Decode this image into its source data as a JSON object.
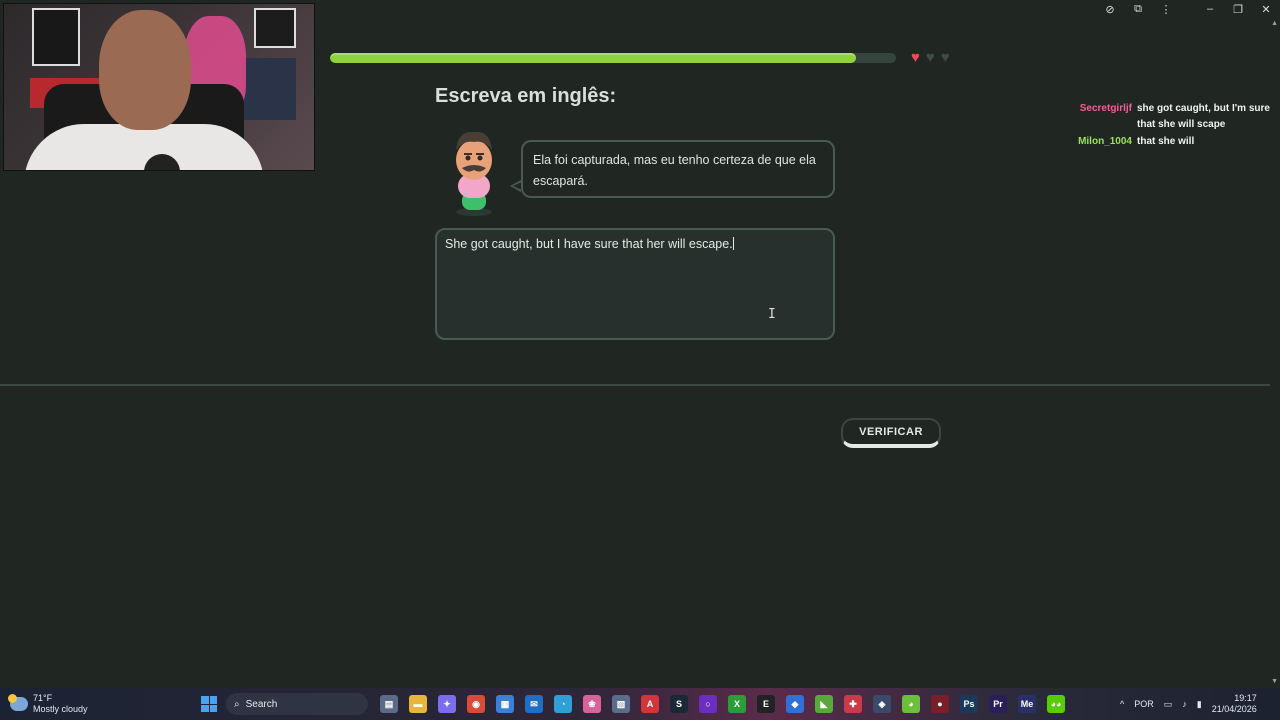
{
  "window": {
    "icons": [
      "eye-slash-icon",
      "extension-icon",
      "more-vert-icon",
      "minimize-icon",
      "restore-icon",
      "close-icon"
    ],
    "glyphs": [
      "⊘",
      "⧉",
      "⋮",
      "–",
      "❐",
      "✕"
    ]
  },
  "lesson": {
    "progress": 0.93,
    "hearts_full": 1,
    "hearts_total": 3,
    "title": "Escreva em inglês:",
    "prompt": "Ela foi capturada, mas eu tenho certeza de que ela escapará.",
    "answer": "She got caught, but I have sure that her will escape.",
    "verify_label": "VERIFICAR"
  },
  "chat": [
    {
      "user": "Secretgirljf",
      "color": "#f0609a",
      "message": "she got caught, but I'm sure that she will scape"
    },
    {
      "user": "Milon_1004",
      "color": "#9be35a",
      "message": "that she will"
    }
  ],
  "taskbar": {
    "temp": "71°F",
    "weather": "Mostly cloudy",
    "search_label": "Search",
    "apps": [
      {
        "name": "file-explorer",
        "label": "▤",
        "color": "#5b6a86"
      },
      {
        "name": "folder",
        "label": "▬",
        "color": "#e6b53a"
      },
      {
        "name": "copilot",
        "label": "✦",
        "color": "#7b6cf0"
      },
      {
        "name": "chrome",
        "label": "◉",
        "color": "#d94a3a"
      },
      {
        "name": "store",
        "label": "▦",
        "color": "#3b7fd6"
      },
      {
        "name": "outlook",
        "label": "✉",
        "color": "#1f6fc8"
      },
      {
        "name": "app-bird",
        "label": "◔",
        "color": "#2f9fd6"
      },
      {
        "name": "photos",
        "label": "❀",
        "color": "#d8629a"
      },
      {
        "name": "app-grid",
        "label": "▧",
        "color": "#5a6e8c"
      },
      {
        "name": "acrobat",
        "label": "A",
        "color": "#d3353a"
      },
      {
        "name": "steam",
        "label": "S",
        "color": "#1b2838"
      },
      {
        "name": "obs",
        "label": "○",
        "color": "#6b2fbf"
      },
      {
        "name": "xbox",
        "label": "X",
        "color": "#2a9d3a"
      },
      {
        "name": "epic",
        "label": "E",
        "color": "#222222"
      },
      {
        "name": "app-blue",
        "label": "◆",
        "color": "#2f6fd6"
      },
      {
        "name": "app-green",
        "label": "◣",
        "color": "#58a83a"
      },
      {
        "name": "app-red",
        "label": "✚",
        "color": "#c93a4a"
      },
      {
        "name": "app-vpn",
        "label": "◈",
        "color": "#3a4a6a"
      },
      {
        "name": "app-lime",
        "label": "◕",
        "color": "#6cbf3a"
      },
      {
        "name": "app-dark-red",
        "label": "●",
        "color": "#7a1f2a"
      },
      {
        "name": "photoshop",
        "label": "Ps",
        "color": "#1b3a5a"
      },
      {
        "name": "premiere",
        "label": "Pr",
        "color": "#2a1f5a"
      },
      {
        "name": "media-encoder",
        "label": "Me",
        "color": "#2a2f6a"
      },
      {
        "name": "duolingo",
        "label": "◕◕",
        "color": "#58cc02"
      }
    ],
    "language": "POR",
    "time": "19:17",
    "date": "21/04/2026"
  }
}
